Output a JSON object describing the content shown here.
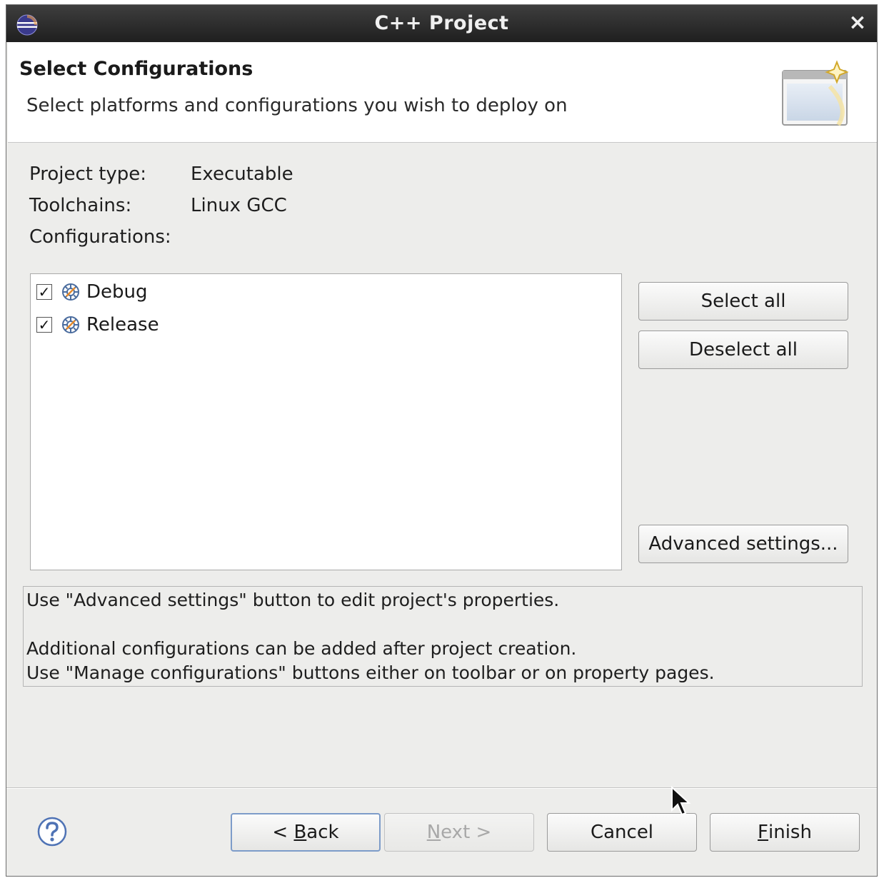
{
  "window": {
    "title": "C++ Project",
    "close_symbol": "×",
    "app_icon": "eclipse-icon",
    "close_icon": "close-icon"
  },
  "header": {
    "title": "Select Configurations",
    "description": "Select platforms and configurations you wish to deploy on",
    "image_icon": "wizard-banner-icon"
  },
  "info": {
    "project_type_label": "Project type:",
    "project_type_value": "Executable",
    "toolchains_label": "Toolchains:",
    "toolchains_value": "Linux GCC",
    "configurations_label": "Configurations:"
  },
  "configurations": [
    {
      "label": "Debug",
      "checked": true,
      "icon": "build-config-icon"
    },
    {
      "label": "Release",
      "checked": true,
      "icon": "build-config-icon"
    }
  ],
  "side_buttons": {
    "select_all": "Select all",
    "deselect_all": "Deselect all",
    "advanced_settings": "Advanced settings..."
  },
  "notes": {
    "line1": "Use \"Advanced settings\" button to edit project's properties.",
    "line2": "Additional configurations can be added after project creation.",
    "line3": "Use \"Manage configurations\" buttons either on toolbar or on property pages."
  },
  "footer": {
    "help_icon": "help-icon",
    "back_prefix": "< ",
    "back_mnemonic": "B",
    "back_rest": "ack",
    "next_mnemonic": "N",
    "next_rest": "ext >",
    "cancel": "Cancel",
    "finish_mnemonic": "F",
    "finish_rest": "inish"
  }
}
